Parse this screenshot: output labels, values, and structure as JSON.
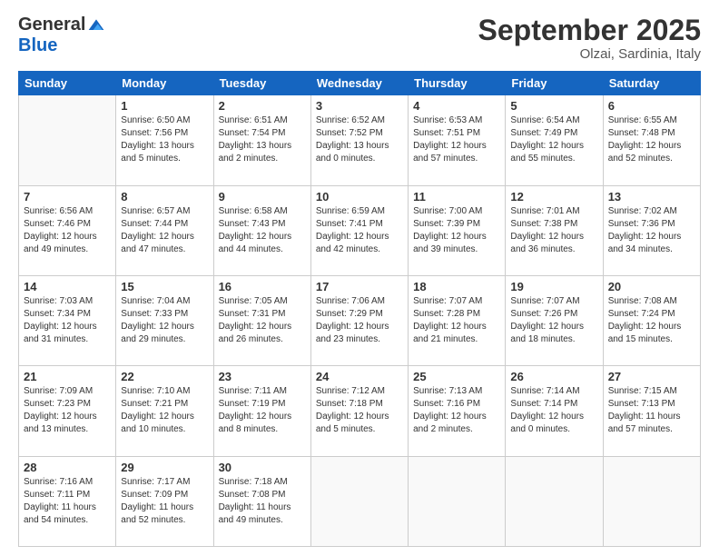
{
  "logo": {
    "general": "General",
    "blue": "Blue"
  },
  "title": "September 2025",
  "subtitle": "Olzai, Sardinia, Italy",
  "days": [
    "Sunday",
    "Monday",
    "Tuesday",
    "Wednesday",
    "Thursday",
    "Friday",
    "Saturday"
  ],
  "weeks": [
    [
      {
        "day": "",
        "info": ""
      },
      {
        "day": "1",
        "info": "Sunrise: 6:50 AM\nSunset: 7:56 PM\nDaylight: 13 hours\nand 5 minutes."
      },
      {
        "day": "2",
        "info": "Sunrise: 6:51 AM\nSunset: 7:54 PM\nDaylight: 13 hours\nand 2 minutes."
      },
      {
        "day": "3",
        "info": "Sunrise: 6:52 AM\nSunset: 7:52 PM\nDaylight: 13 hours\nand 0 minutes."
      },
      {
        "day": "4",
        "info": "Sunrise: 6:53 AM\nSunset: 7:51 PM\nDaylight: 12 hours\nand 57 minutes."
      },
      {
        "day": "5",
        "info": "Sunrise: 6:54 AM\nSunset: 7:49 PM\nDaylight: 12 hours\nand 55 minutes."
      },
      {
        "day": "6",
        "info": "Sunrise: 6:55 AM\nSunset: 7:48 PM\nDaylight: 12 hours\nand 52 minutes."
      }
    ],
    [
      {
        "day": "7",
        "info": "Sunrise: 6:56 AM\nSunset: 7:46 PM\nDaylight: 12 hours\nand 49 minutes."
      },
      {
        "day": "8",
        "info": "Sunrise: 6:57 AM\nSunset: 7:44 PM\nDaylight: 12 hours\nand 47 minutes."
      },
      {
        "day": "9",
        "info": "Sunrise: 6:58 AM\nSunset: 7:43 PM\nDaylight: 12 hours\nand 44 minutes."
      },
      {
        "day": "10",
        "info": "Sunrise: 6:59 AM\nSunset: 7:41 PM\nDaylight: 12 hours\nand 42 minutes."
      },
      {
        "day": "11",
        "info": "Sunrise: 7:00 AM\nSunset: 7:39 PM\nDaylight: 12 hours\nand 39 minutes."
      },
      {
        "day": "12",
        "info": "Sunrise: 7:01 AM\nSunset: 7:38 PM\nDaylight: 12 hours\nand 36 minutes."
      },
      {
        "day": "13",
        "info": "Sunrise: 7:02 AM\nSunset: 7:36 PM\nDaylight: 12 hours\nand 34 minutes."
      }
    ],
    [
      {
        "day": "14",
        "info": "Sunrise: 7:03 AM\nSunset: 7:34 PM\nDaylight: 12 hours\nand 31 minutes."
      },
      {
        "day": "15",
        "info": "Sunrise: 7:04 AM\nSunset: 7:33 PM\nDaylight: 12 hours\nand 29 minutes."
      },
      {
        "day": "16",
        "info": "Sunrise: 7:05 AM\nSunset: 7:31 PM\nDaylight: 12 hours\nand 26 minutes."
      },
      {
        "day": "17",
        "info": "Sunrise: 7:06 AM\nSunset: 7:29 PM\nDaylight: 12 hours\nand 23 minutes."
      },
      {
        "day": "18",
        "info": "Sunrise: 7:07 AM\nSunset: 7:28 PM\nDaylight: 12 hours\nand 21 minutes."
      },
      {
        "day": "19",
        "info": "Sunrise: 7:07 AM\nSunset: 7:26 PM\nDaylight: 12 hours\nand 18 minutes."
      },
      {
        "day": "20",
        "info": "Sunrise: 7:08 AM\nSunset: 7:24 PM\nDaylight: 12 hours\nand 15 minutes."
      }
    ],
    [
      {
        "day": "21",
        "info": "Sunrise: 7:09 AM\nSunset: 7:23 PM\nDaylight: 12 hours\nand 13 minutes."
      },
      {
        "day": "22",
        "info": "Sunrise: 7:10 AM\nSunset: 7:21 PM\nDaylight: 12 hours\nand 10 minutes."
      },
      {
        "day": "23",
        "info": "Sunrise: 7:11 AM\nSunset: 7:19 PM\nDaylight: 12 hours\nand 8 minutes."
      },
      {
        "day": "24",
        "info": "Sunrise: 7:12 AM\nSunset: 7:18 PM\nDaylight: 12 hours\nand 5 minutes."
      },
      {
        "day": "25",
        "info": "Sunrise: 7:13 AM\nSunset: 7:16 PM\nDaylight: 12 hours\nand 2 minutes."
      },
      {
        "day": "26",
        "info": "Sunrise: 7:14 AM\nSunset: 7:14 PM\nDaylight: 12 hours\nand 0 minutes."
      },
      {
        "day": "27",
        "info": "Sunrise: 7:15 AM\nSunset: 7:13 PM\nDaylight: 11 hours\nand 57 minutes."
      }
    ],
    [
      {
        "day": "28",
        "info": "Sunrise: 7:16 AM\nSunset: 7:11 PM\nDaylight: 11 hours\nand 54 minutes."
      },
      {
        "day": "29",
        "info": "Sunrise: 7:17 AM\nSunset: 7:09 PM\nDaylight: 11 hours\nand 52 minutes."
      },
      {
        "day": "30",
        "info": "Sunrise: 7:18 AM\nSunset: 7:08 PM\nDaylight: 11 hours\nand 49 minutes."
      },
      {
        "day": "",
        "info": ""
      },
      {
        "day": "",
        "info": ""
      },
      {
        "day": "",
        "info": ""
      },
      {
        "day": "",
        "info": ""
      }
    ]
  ]
}
